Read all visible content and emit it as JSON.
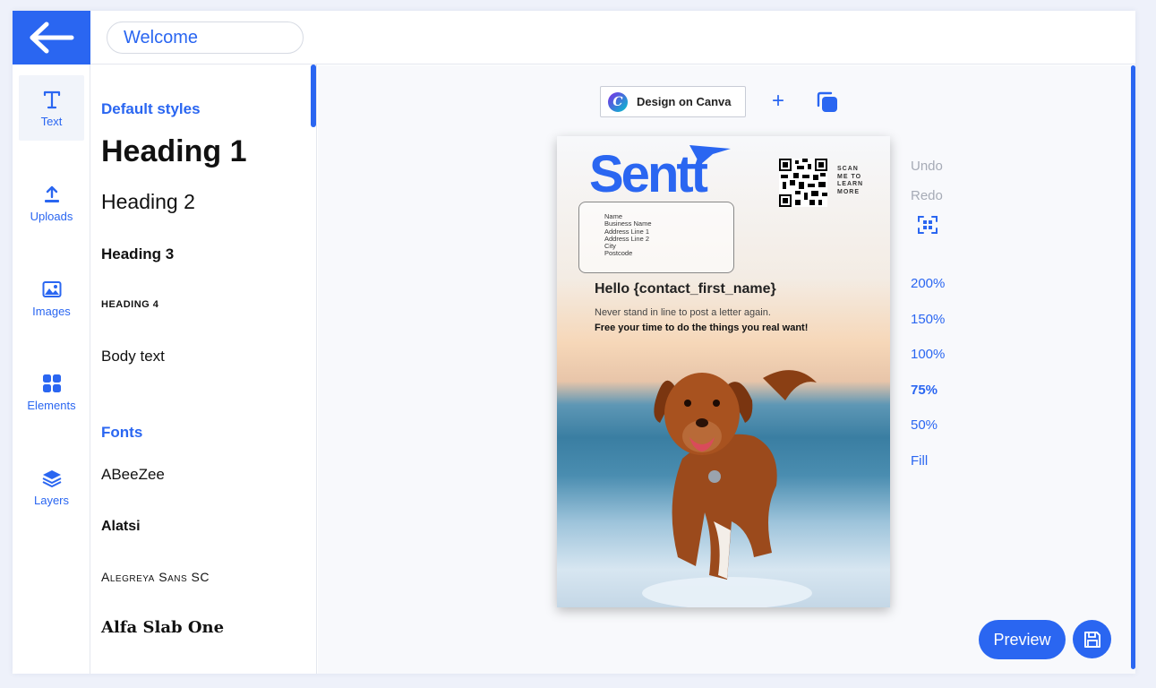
{
  "header": {
    "title_value": "Welcome"
  },
  "nav": [
    {
      "label": "Text",
      "icon": "text-icon"
    },
    {
      "label": "Uploads",
      "icon": "upload-icon"
    },
    {
      "label": "Images",
      "icon": "image-icon"
    },
    {
      "label": "Elements",
      "icon": "grid-icon"
    },
    {
      "label": "Layers",
      "icon": "layers-icon"
    }
  ],
  "panel": {
    "default_styles_title": "Default styles",
    "heading1": "Heading 1",
    "heading2": "Heading 2",
    "heading3": "Heading 3",
    "heading4": "HEADING 4",
    "body_text": "Body text",
    "fonts_title": "Fonts",
    "fonts": [
      "ABeeZee",
      "Alatsi",
      "Alegreya Sans SC",
      "Alfa Slab One"
    ]
  },
  "toolbar": {
    "canva_label": "Design on Canva",
    "plus_label": "+"
  },
  "design": {
    "brand": "Sentt",
    "scan_text": [
      "SCAN",
      "ME TO",
      "LEARN",
      "MORE"
    ],
    "address_lines": [
      "Name",
      "Business Name",
      "Address Line 1",
      "Address Line 2",
      "City",
      "Postcode"
    ],
    "greeting": "Hello {contact_first_name}",
    "line1": "Never stand in line to post a letter again.",
    "line2": "Free your time to do the things you real want!"
  },
  "controls": {
    "undo": "Undo",
    "redo": "Redo",
    "zoom_levels": [
      "200%",
      "150%",
      "100%",
      "75%",
      "50%",
      "Fill"
    ],
    "active_zoom": "75%",
    "preview": "Preview"
  },
  "colors": {
    "accent": "#2a66f1"
  }
}
